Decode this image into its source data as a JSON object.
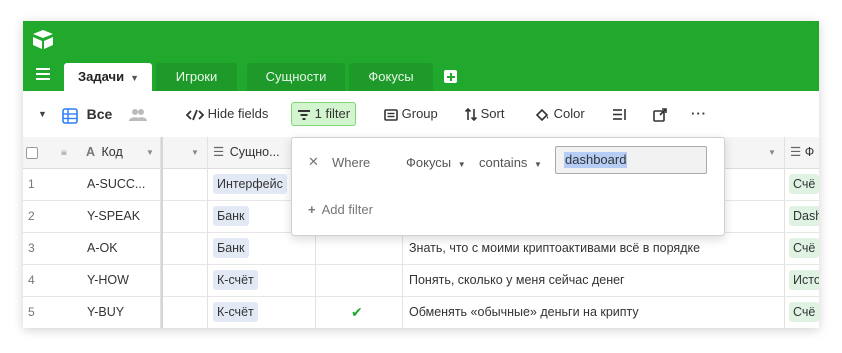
{
  "tabs": [
    {
      "label": "Задачи"
    },
    {
      "label": "Игроки"
    },
    {
      "label": "Сущности"
    },
    {
      "label": "Фокусы"
    }
  ],
  "viewbar": {
    "view_name": "Все",
    "hide_fields": "Hide fields",
    "filter": "1 filter",
    "group": "Group",
    "sort": "Sort",
    "color": "Color"
  },
  "columns": {
    "code": "Код",
    "entity": "Сущно...",
    "focus": "Ф"
  },
  "rows": [
    {
      "num": "1",
      "code": "A-SUCC...",
      "entity": "Интерфейс",
      "check": "",
      "goal": "",
      "focus": "Счё"
    },
    {
      "num": "2",
      "code": "Y-SPEAK",
      "entity": "Банк",
      "check": "",
      "goal": "",
      "focus": "Dash"
    },
    {
      "num": "3",
      "code": "A-OK",
      "entity": "Банк",
      "check": "",
      "goal": "Знать, что с моими криптоактивами всё в порядке",
      "focus": "Счё"
    },
    {
      "num": "4",
      "code": "Y-HOW",
      "entity": "К-счёт",
      "check": "",
      "goal": "Понять, сколько у меня сейчас денег",
      "focus": "Исто"
    },
    {
      "num": "5",
      "code": "Y-BUY",
      "entity": "К-счёт",
      "check": "✔",
      "goal": "Обменять «обычные» деньги на крипту",
      "focus": "Счё"
    }
  ],
  "filter_popup": {
    "where": "Where",
    "field": "Фокусы",
    "operator": "contains",
    "value": "dashboard",
    "add_filter": "Add filter"
  },
  "colors": {
    "brand": "#20a92c",
    "filter_active": "#d2f4cf"
  }
}
